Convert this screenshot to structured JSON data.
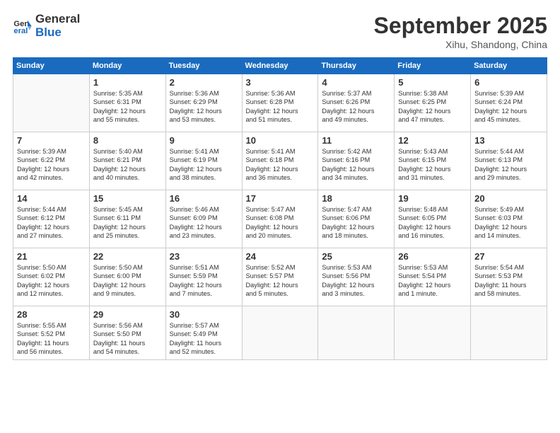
{
  "header": {
    "logo_line1": "General",
    "logo_line2": "Blue",
    "month": "September 2025",
    "location": "Xihu, Shandong, China"
  },
  "days_of_week": [
    "Sunday",
    "Monday",
    "Tuesday",
    "Wednesday",
    "Thursday",
    "Friday",
    "Saturday"
  ],
  "weeks": [
    [
      {
        "day": "",
        "info": ""
      },
      {
        "day": "1",
        "info": "Sunrise: 5:35 AM\nSunset: 6:31 PM\nDaylight: 12 hours\nand 55 minutes."
      },
      {
        "day": "2",
        "info": "Sunrise: 5:36 AM\nSunset: 6:29 PM\nDaylight: 12 hours\nand 53 minutes."
      },
      {
        "day": "3",
        "info": "Sunrise: 5:36 AM\nSunset: 6:28 PM\nDaylight: 12 hours\nand 51 minutes."
      },
      {
        "day": "4",
        "info": "Sunrise: 5:37 AM\nSunset: 6:26 PM\nDaylight: 12 hours\nand 49 minutes."
      },
      {
        "day": "5",
        "info": "Sunrise: 5:38 AM\nSunset: 6:25 PM\nDaylight: 12 hours\nand 47 minutes."
      },
      {
        "day": "6",
        "info": "Sunrise: 5:39 AM\nSunset: 6:24 PM\nDaylight: 12 hours\nand 45 minutes."
      }
    ],
    [
      {
        "day": "7",
        "info": "Sunrise: 5:39 AM\nSunset: 6:22 PM\nDaylight: 12 hours\nand 42 minutes."
      },
      {
        "day": "8",
        "info": "Sunrise: 5:40 AM\nSunset: 6:21 PM\nDaylight: 12 hours\nand 40 minutes."
      },
      {
        "day": "9",
        "info": "Sunrise: 5:41 AM\nSunset: 6:19 PM\nDaylight: 12 hours\nand 38 minutes."
      },
      {
        "day": "10",
        "info": "Sunrise: 5:41 AM\nSunset: 6:18 PM\nDaylight: 12 hours\nand 36 minutes."
      },
      {
        "day": "11",
        "info": "Sunrise: 5:42 AM\nSunset: 6:16 PM\nDaylight: 12 hours\nand 34 minutes."
      },
      {
        "day": "12",
        "info": "Sunrise: 5:43 AM\nSunset: 6:15 PM\nDaylight: 12 hours\nand 31 minutes."
      },
      {
        "day": "13",
        "info": "Sunrise: 5:44 AM\nSunset: 6:13 PM\nDaylight: 12 hours\nand 29 minutes."
      }
    ],
    [
      {
        "day": "14",
        "info": "Sunrise: 5:44 AM\nSunset: 6:12 PM\nDaylight: 12 hours\nand 27 minutes."
      },
      {
        "day": "15",
        "info": "Sunrise: 5:45 AM\nSunset: 6:11 PM\nDaylight: 12 hours\nand 25 minutes."
      },
      {
        "day": "16",
        "info": "Sunrise: 5:46 AM\nSunset: 6:09 PM\nDaylight: 12 hours\nand 23 minutes."
      },
      {
        "day": "17",
        "info": "Sunrise: 5:47 AM\nSunset: 6:08 PM\nDaylight: 12 hours\nand 20 minutes."
      },
      {
        "day": "18",
        "info": "Sunrise: 5:47 AM\nSunset: 6:06 PM\nDaylight: 12 hours\nand 18 minutes."
      },
      {
        "day": "19",
        "info": "Sunrise: 5:48 AM\nSunset: 6:05 PM\nDaylight: 12 hours\nand 16 minutes."
      },
      {
        "day": "20",
        "info": "Sunrise: 5:49 AM\nSunset: 6:03 PM\nDaylight: 12 hours\nand 14 minutes."
      }
    ],
    [
      {
        "day": "21",
        "info": "Sunrise: 5:50 AM\nSunset: 6:02 PM\nDaylight: 12 hours\nand 12 minutes."
      },
      {
        "day": "22",
        "info": "Sunrise: 5:50 AM\nSunset: 6:00 PM\nDaylight: 12 hours\nand 9 minutes."
      },
      {
        "day": "23",
        "info": "Sunrise: 5:51 AM\nSunset: 5:59 PM\nDaylight: 12 hours\nand 7 minutes."
      },
      {
        "day": "24",
        "info": "Sunrise: 5:52 AM\nSunset: 5:57 PM\nDaylight: 12 hours\nand 5 minutes."
      },
      {
        "day": "25",
        "info": "Sunrise: 5:53 AM\nSunset: 5:56 PM\nDaylight: 12 hours\nand 3 minutes."
      },
      {
        "day": "26",
        "info": "Sunrise: 5:53 AM\nSunset: 5:54 PM\nDaylight: 12 hours\nand 1 minute."
      },
      {
        "day": "27",
        "info": "Sunrise: 5:54 AM\nSunset: 5:53 PM\nDaylight: 11 hours\nand 58 minutes."
      }
    ],
    [
      {
        "day": "28",
        "info": "Sunrise: 5:55 AM\nSunset: 5:52 PM\nDaylight: 11 hours\nand 56 minutes."
      },
      {
        "day": "29",
        "info": "Sunrise: 5:56 AM\nSunset: 5:50 PM\nDaylight: 11 hours\nand 54 minutes."
      },
      {
        "day": "30",
        "info": "Sunrise: 5:57 AM\nSunset: 5:49 PM\nDaylight: 11 hours\nand 52 minutes."
      },
      {
        "day": "",
        "info": ""
      },
      {
        "day": "",
        "info": ""
      },
      {
        "day": "",
        "info": ""
      },
      {
        "day": "",
        "info": ""
      }
    ]
  ]
}
